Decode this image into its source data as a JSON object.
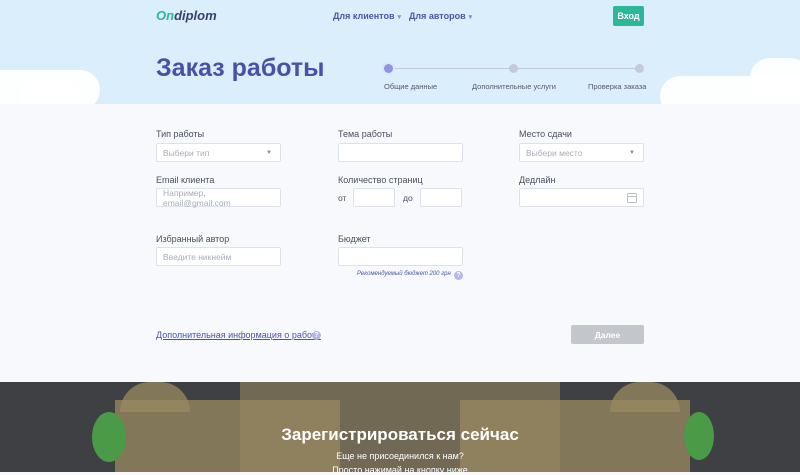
{
  "header": {
    "logo_on": "On",
    "logo_rest": "diplom",
    "nav_clients": "Для клиентов",
    "nav_authors": "Для авторов",
    "login_label": "Вход",
    "page_title": "Заказ работы"
  },
  "steps": [
    {
      "label": "Общие данные"
    },
    {
      "label": "Дополнительные услуги"
    },
    {
      "label": "Проверка заказа"
    }
  ],
  "form": {
    "type_label": "Тип работы",
    "type_placeholder": "Выбери тип",
    "topic_label": "Тема работы",
    "topic_value": "",
    "place_label": "Место сдачи",
    "place_placeholder": "Выбери место",
    "email_label": "Email клиента",
    "email_placeholder": "Например, email@gmail.com",
    "pages_label": "Количество страниц",
    "pages_from": "от",
    "pages_to": "до",
    "deadline_label": "Дедлайн",
    "author_label": "Избранный автор",
    "author_placeholder": "Введите никнейм",
    "budget_label": "Бюджет",
    "budget_hint": "Рекомендуемый бюджет 200 грн",
    "more_info": "Дополнительная информация о работе",
    "submit_label": "Далее"
  },
  "footer": {
    "title": "Зарегистрироваться сейчас",
    "line1": "Еще не присоединился к нам?",
    "line2": "Просто нажимай на кнопку ниже"
  },
  "colors": {
    "accent": "#2db79a",
    "primary": "#4a4fa8",
    "hero_bg": "#dbeefb",
    "footer_bg": "#3f4043"
  },
  "icons": {
    "dropdown": "chevron-down-icon",
    "calendar": "calendar-icon",
    "help": "question-icon"
  }
}
